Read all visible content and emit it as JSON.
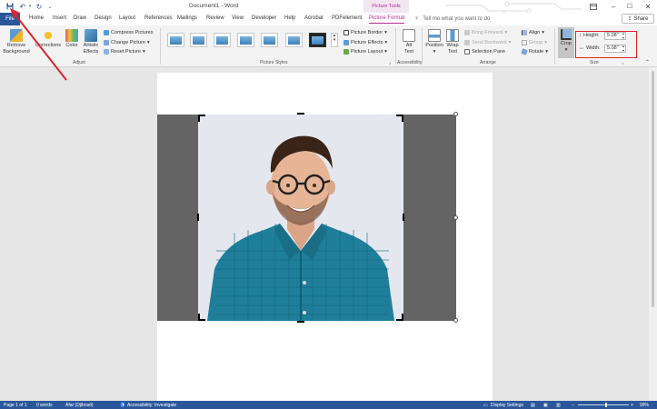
{
  "titlebar": {
    "document_title": "Document1 - Word",
    "contextual_group": "Picture Tools"
  },
  "tabs": [
    "File",
    "Home",
    "Insert",
    "Draw",
    "Design",
    "Layout",
    "References",
    "Mailings",
    "Review",
    "View",
    "Developer",
    "Help",
    "Acrobat",
    "PDFelement",
    "Picture Format"
  ],
  "active_tab": "Picture Format",
  "tell_me_placeholder": "Tell me what you want to do",
  "share_label": "Share",
  "ribbon": {
    "adjust": {
      "remove_background": [
        "Remove",
        "Background"
      ],
      "corrections": "Corrections",
      "color": "Color",
      "artistic_effects": [
        "Artistic",
        "Effects"
      ],
      "compress": "Compress Pictures",
      "change": "Change Picture",
      "reset": "Reset Picture",
      "group_label": "Adjust"
    },
    "picture_styles": {
      "border": "Picture Border",
      "effects": "Picture Effects",
      "layout": "Picture Layout",
      "group_label": "Picture Styles"
    },
    "accessibility": {
      "alt_text": [
        "Alt",
        "Text"
      ],
      "group_label": "Accessibility"
    },
    "arrange": {
      "position": "Position",
      "wrap_text": [
        "Wrap",
        "Text"
      ],
      "bring_forward": "Bring Forward",
      "send_backward": "Send Backward",
      "selection_pane": "Selection Pane",
      "align": "Align",
      "group": "Group",
      "rotate": "Rotate",
      "group_label": "Arrange"
    },
    "size": {
      "crop": "Crop",
      "height_label": "Height:",
      "height_value": "5.08\"",
      "width_label": "Width:",
      "width_value": "5.08\"",
      "group_label": "Size"
    }
  },
  "statusbar": {
    "page": "Page 1 of 1",
    "words": "0 words",
    "language": "Afar (Djibouti)",
    "accessibility": "Accessibility: Investigate",
    "display_settings": "Display Settings",
    "zoom": "99%"
  },
  "colors": {
    "word_blue": "#2b579a",
    "picture_tools_accent": "#b02c93",
    "annotation_red": "#e0202d"
  }
}
